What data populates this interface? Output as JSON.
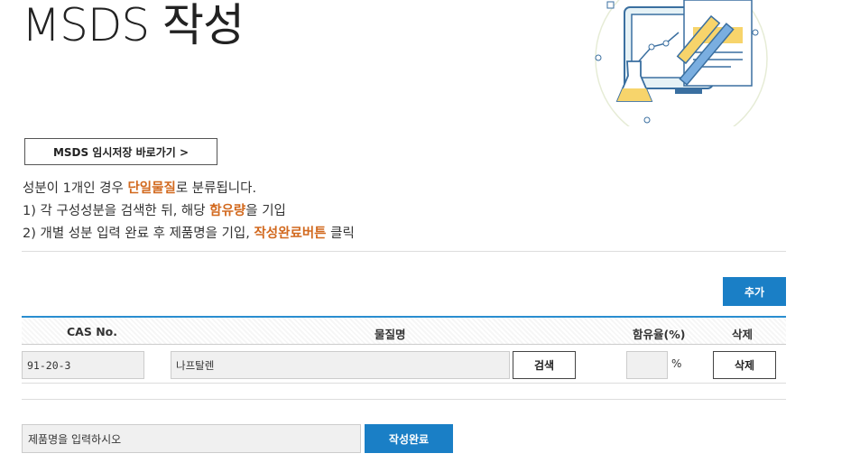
{
  "page": {
    "title": "MSDS 작성"
  },
  "temp_save_link": {
    "label": "MSDS 임시저장 바로가기 >"
  },
  "description": {
    "line1_a": "성분이 1개인 경우 ",
    "line1_hl": "단일물질",
    "line1_b": "로 분류됩니다.",
    "line2_a": "1) 각 구성성분을 검색한 뒤, 해당 ",
    "line2_hl": "함유량",
    "line2_b": "을 기입",
    "line3_a": "2) 개별 성분 입력 완료 후 제품명을 기입, ",
    "line3_hl": "작성완료버튼",
    "line3_b": " 클릭"
  },
  "add_button": {
    "label": "추가"
  },
  "table": {
    "headers": {
      "cas": "CAS No.",
      "name": "물질명",
      "content": "함유율(%)",
      "delete": "삭제"
    },
    "rows": [
      {
        "cas": "91-20-3",
        "name": "나프탈렌",
        "search_label": "검색",
        "content": "",
        "unit": "%",
        "delete_label": "삭제"
      }
    ]
  },
  "product": {
    "placeholder": "제품명을 입력하시오",
    "submit_label": "작성완료"
  },
  "colors": {
    "accent": "#1a7fc6",
    "highlight": "#d2691e"
  }
}
